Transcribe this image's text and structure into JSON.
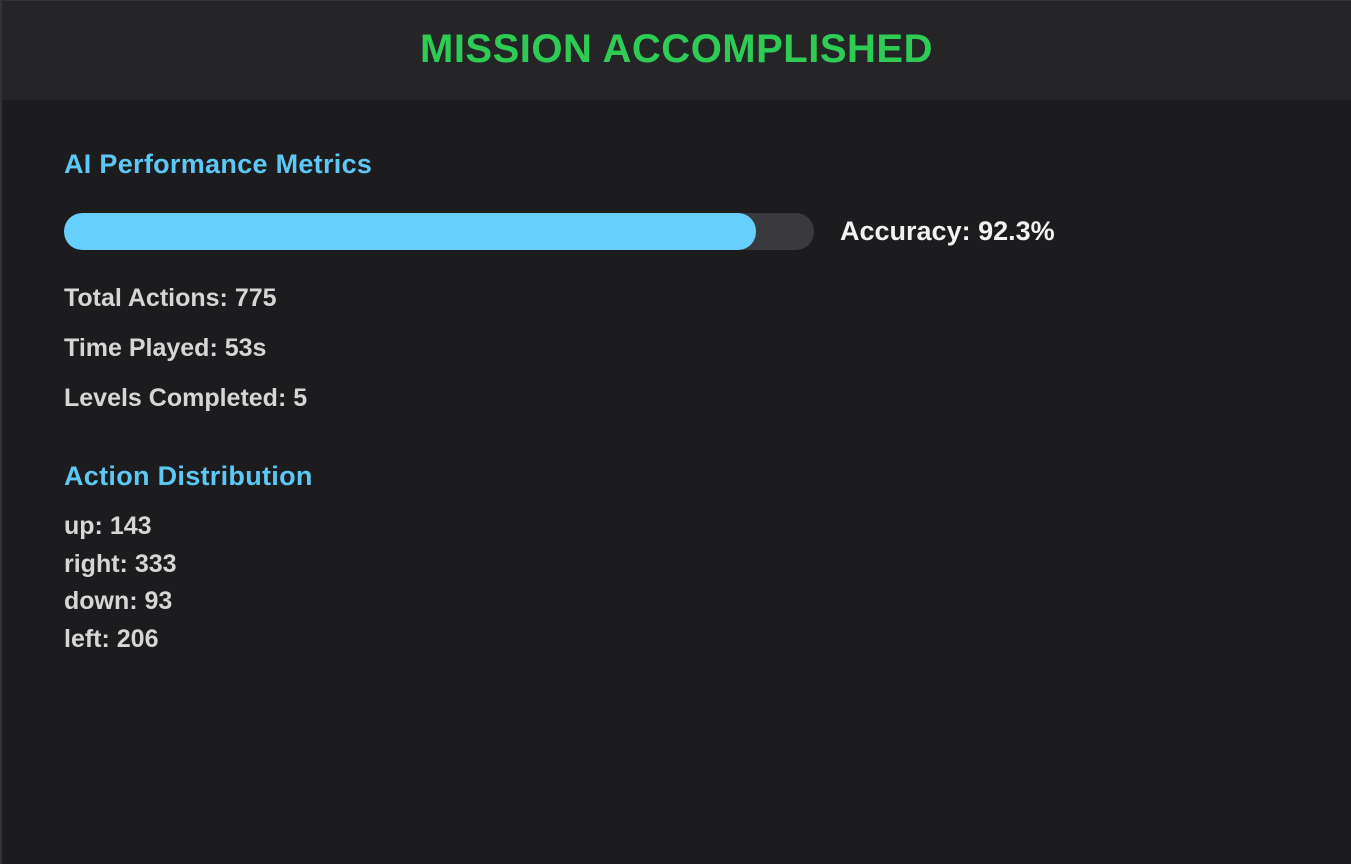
{
  "header": {
    "title": "MISSION ACCOMPLISHED",
    "title_color": "#2ecc55"
  },
  "metrics": {
    "title": "AI Performance Metrics",
    "accuracy_label": "Accuracy: 92.3%",
    "accuracy_fraction": 0.923,
    "bar_color": "#66cfff",
    "total_actions": "Total Actions: 775",
    "time_played": "Time Played: 53s",
    "levels_completed": "Levels Completed: 5"
  },
  "distribution": {
    "title": "Action Distribution",
    "items": [
      {
        "text": "up: 143"
      },
      {
        "text": "right: 333"
      },
      {
        "text": "down: 93"
      },
      {
        "text": "left: 206"
      }
    ]
  }
}
